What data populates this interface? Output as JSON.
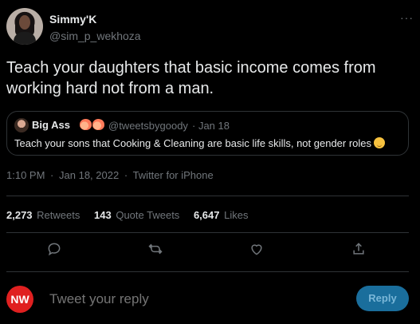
{
  "author": {
    "name": "Simmy'K",
    "handle": "@sim_p_wekhoza"
  },
  "more_label": "···",
  "tweet": {
    "text": "Teach your daughters that basic income comes from working hard not from a man.",
    "time": "1:10 PM",
    "date": "Jan 18, 2022",
    "source": "Twitter for iPhone",
    "separator": "·"
  },
  "quote": {
    "name": "Big Ass",
    "handle": "@tweetsbygoody",
    "date": "· Jan 18",
    "text": "Teach your sons that Cooking & Cleaning are basic life skills, not gender roles"
  },
  "stats": [
    {
      "value": "2,273",
      "label": "Retweets"
    },
    {
      "value": "143",
      "label": "Quote Tweets"
    },
    {
      "value": "6,647",
      "label": "Likes"
    }
  ],
  "reply": {
    "logo_text": "NW",
    "placeholder": "Tweet your reply",
    "button_label": "Reply"
  },
  "icons": [
    "reply-icon",
    "retweet-icon",
    "like-icon",
    "share-icon",
    "peach-emoji",
    "wink-emoji"
  ],
  "colors": {
    "background": "#000000",
    "text": "#e7e9ea",
    "muted": "#71767b",
    "divider": "#2f3336",
    "reply_button": "#1a6e9c",
    "nw_logo": "#e02020"
  }
}
